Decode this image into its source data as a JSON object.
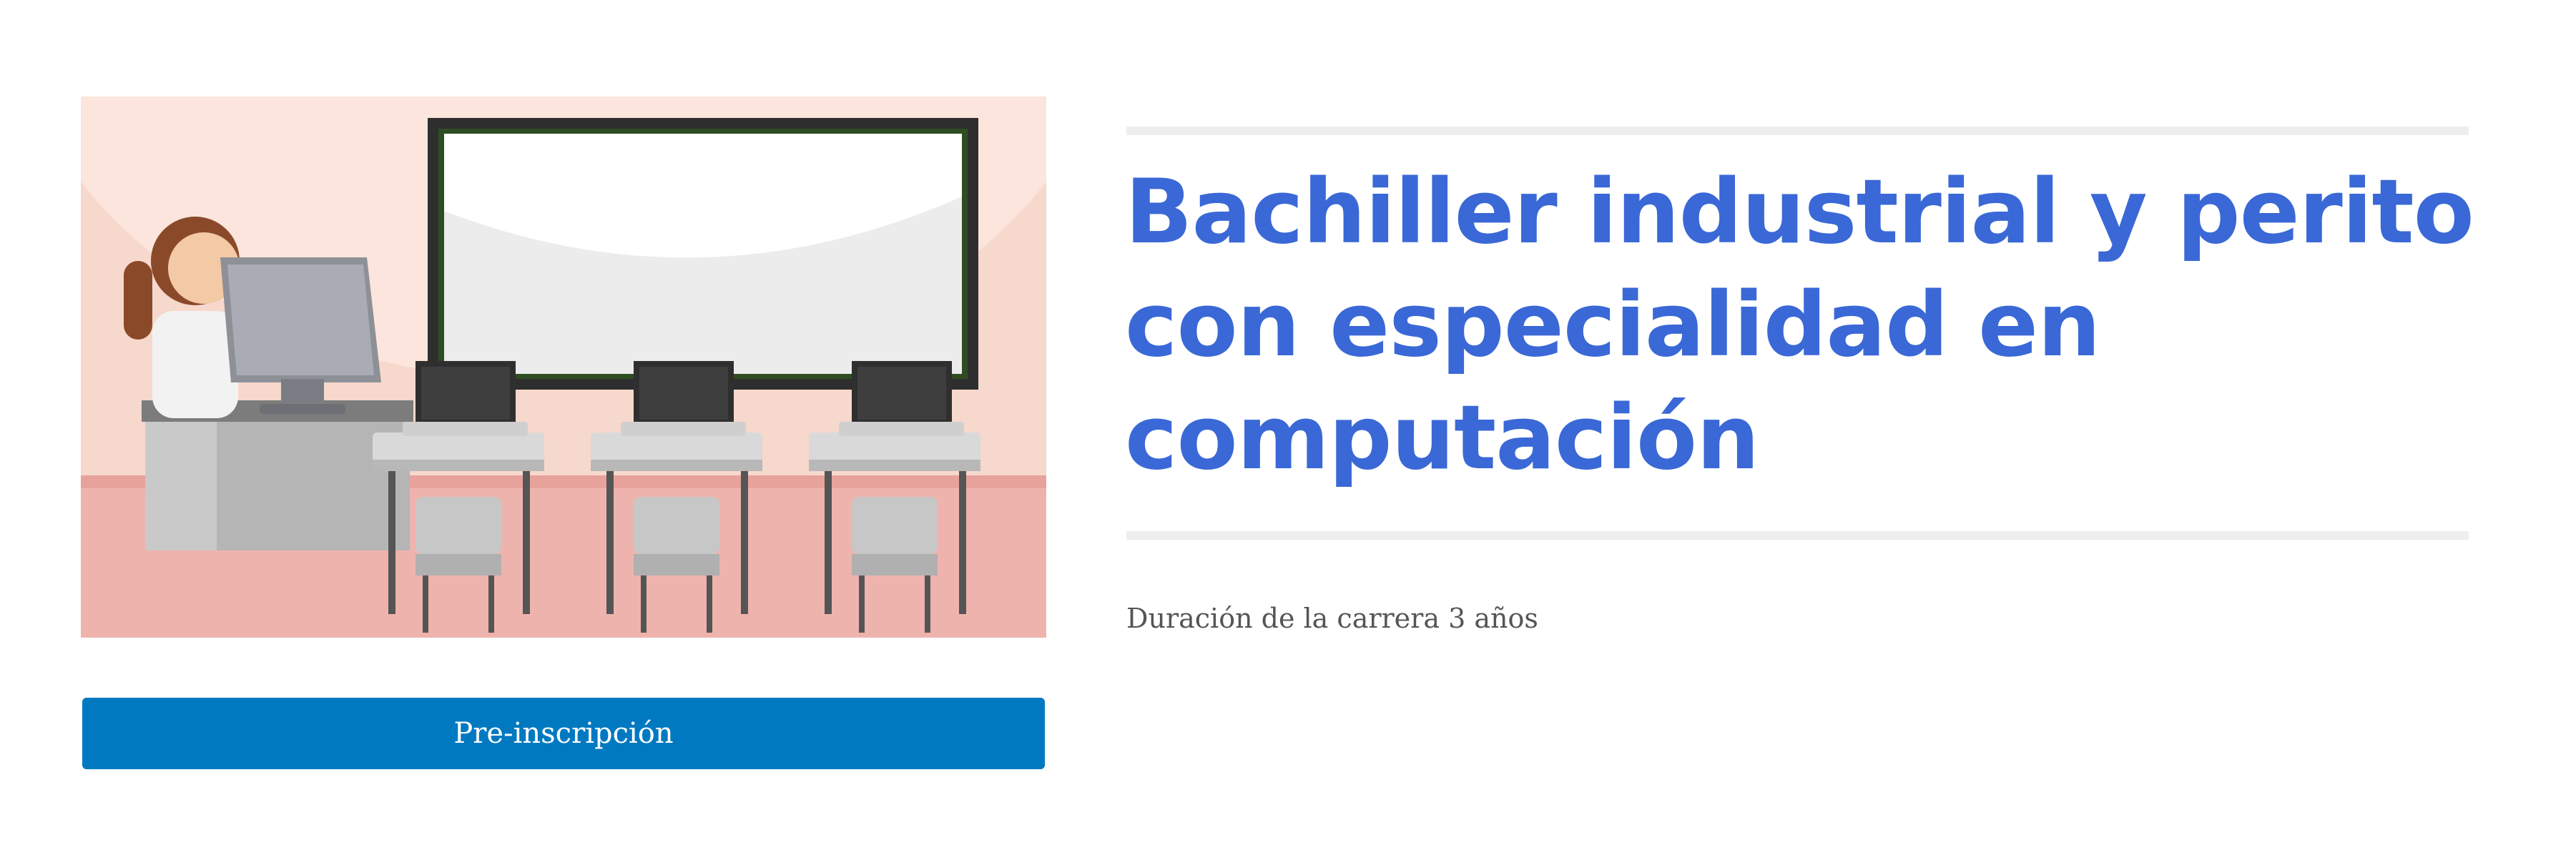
{
  "hero": {
    "image_description_icon": "classroom-illustration"
  },
  "button": {
    "label": "Pre-inscripción",
    "color": "#0079c1"
  },
  "title": {
    "lines": [
      "Bachiller industrial y perito",
      "con especialidad en",
      "computación"
    ],
    "color": "#3a68d6"
  },
  "duration": {
    "text": "Duración de la carrera 3 años"
  }
}
